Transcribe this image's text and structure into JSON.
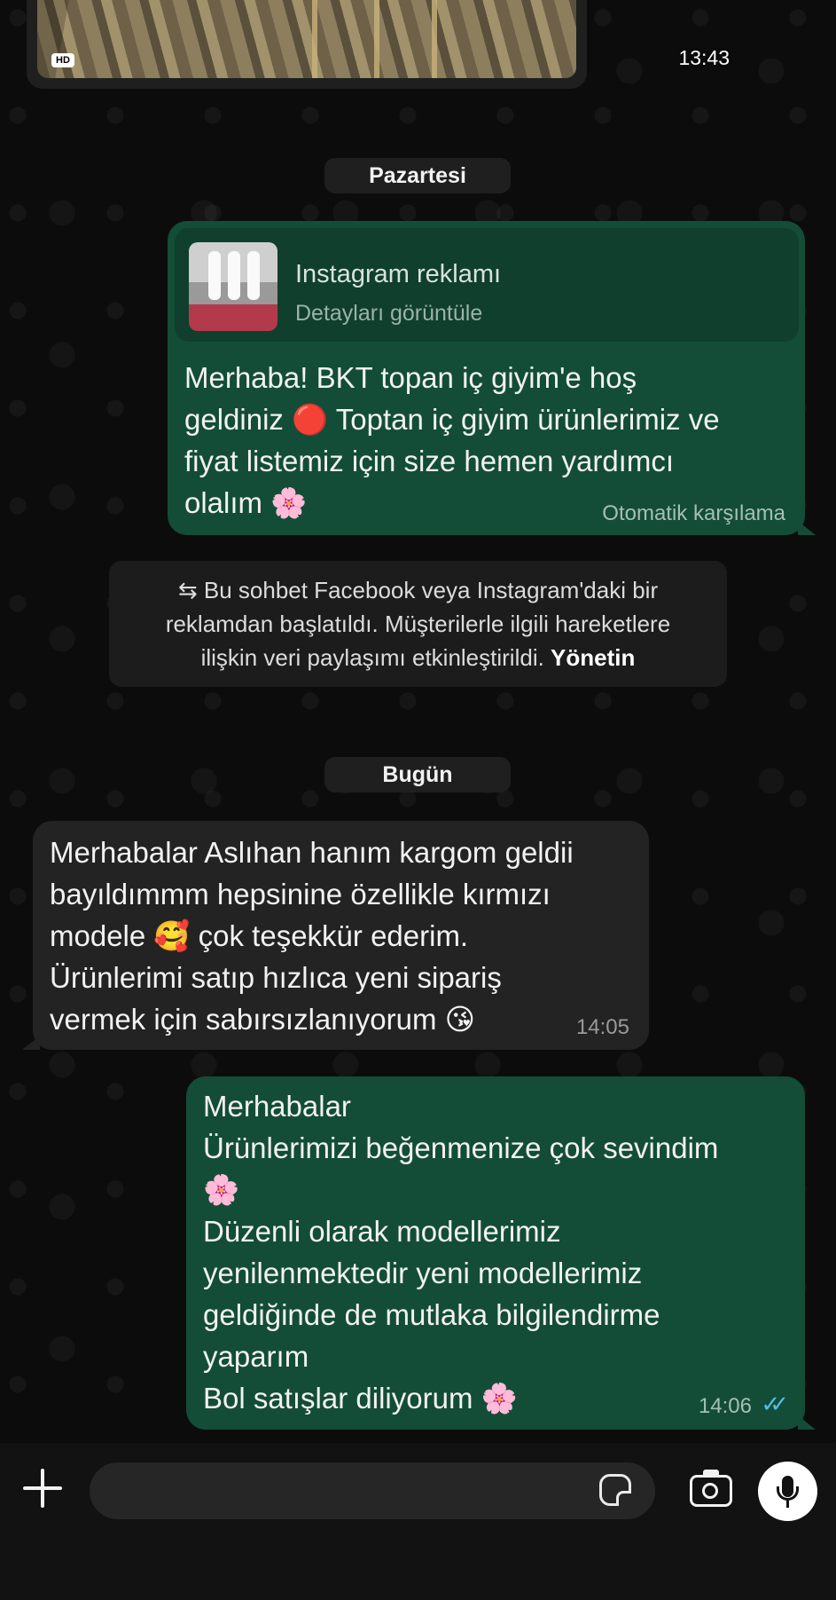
{
  "media": {
    "badge": "HD",
    "time": "13:43"
  },
  "dates": {
    "first": "Pazartesi",
    "second": "Bugün"
  },
  "ad_message": {
    "card_title": "Instagram reklamı",
    "card_subtitle": "Detayları görüntüle",
    "text": "Merhaba! BKT topan iç giyim'e hoş\ngeldiniz 🔴 Toptan iç giyim ürünlerimiz ve\nfiyat listemiz için size hemen yardımcı\nolalım 🌸",
    "footer": "Otomatik karşılama"
  },
  "notice": {
    "icon": "swap-arrows-icon",
    "text": "⇆ Bu sohbet Facebook veya Instagram'daki bir\nreklamdan başlatıldı. Müşterilerle ilgili hareketlere\nilişkin veri paylaşımı etkinleştirildi. ",
    "link": "Yönetin"
  },
  "incoming_message": {
    "text": "Merhabalar Aslıhan hanım kargom geldii\nbayıldımmm hepsinine  özellikle kırmızı\nmodele 🥰 çok teşekkür ederim.\nÜrünlerimi satıp hızlıca yeni sipariş\nvermek için sabırsızlanıyorum 😘",
    "time": "14:05"
  },
  "outgoing_message": {
    "text": "Merhabalar\nÜrünlerimizi beğenmenize çok sevindim\n🌸\nDüzenli olarak modellerimiz\nyenilenmektedir  yeni modellerimiz\ngeldiğinde de mutlaka bilgilendirme\nyaparım\nBol satışlar diliyorum 🌸",
    "time": "14:06",
    "status": "✓✓"
  },
  "composer": {
    "icons": [
      "plus-icon",
      "sticker-icon",
      "camera-icon",
      "microphone-icon"
    ],
    "accent": "#134d37",
    "read_color": "#53bdeb"
  }
}
